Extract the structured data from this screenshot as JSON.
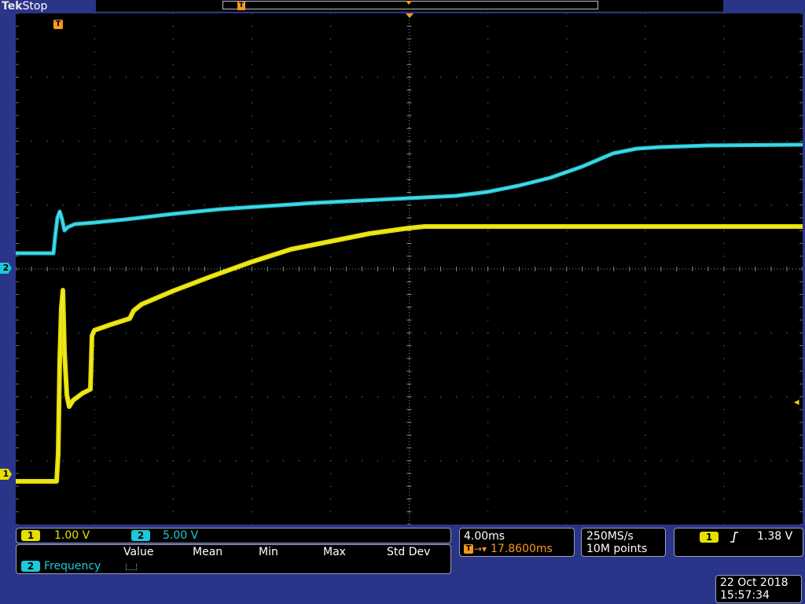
{
  "header": {
    "brand": "Tek",
    "status": "Stop",
    "trigger_marker": "T"
  },
  "markers": {
    "ch1": "1",
    "ch2": "2",
    "trigger_position": "T",
    "trigger_level_arrow": "◂"
  },
  "channels": {
    "ch1": {
      "label": "1",
      "scale": "1.00 V",
      "color": "#e6e000"
    },
    "ch2": {
      "label": "2",
      "scale": "5.00 V",
      "color": "#1ec8d8"
    }
  },
  "measurement": {
    "columns": [
      "Value",
      "Mean",
      "Min",
      "Max",
      "Std Dev"
    ],
    "row": {
      "channel": "2",
      "name": "Frequency",
      "value_icon": "small-bracket-icon"
    }
  },
  "horizontal": {
    "time_per_div": "4.00ms",
    "trigger_delay": "17.8600ms"
  },
  "acquisition": {
    "sample_rate": "250MS/s",
    "record_length": "10M points"
  },
  "trigger": {
    "source": "1",
    "slope_icon": "rising-edge-icon",
    "level": "1.38 V"
  },
  "datetime": {
    "date": "22 Oct  2018",
    "time": "15:57:34"
  }
}
